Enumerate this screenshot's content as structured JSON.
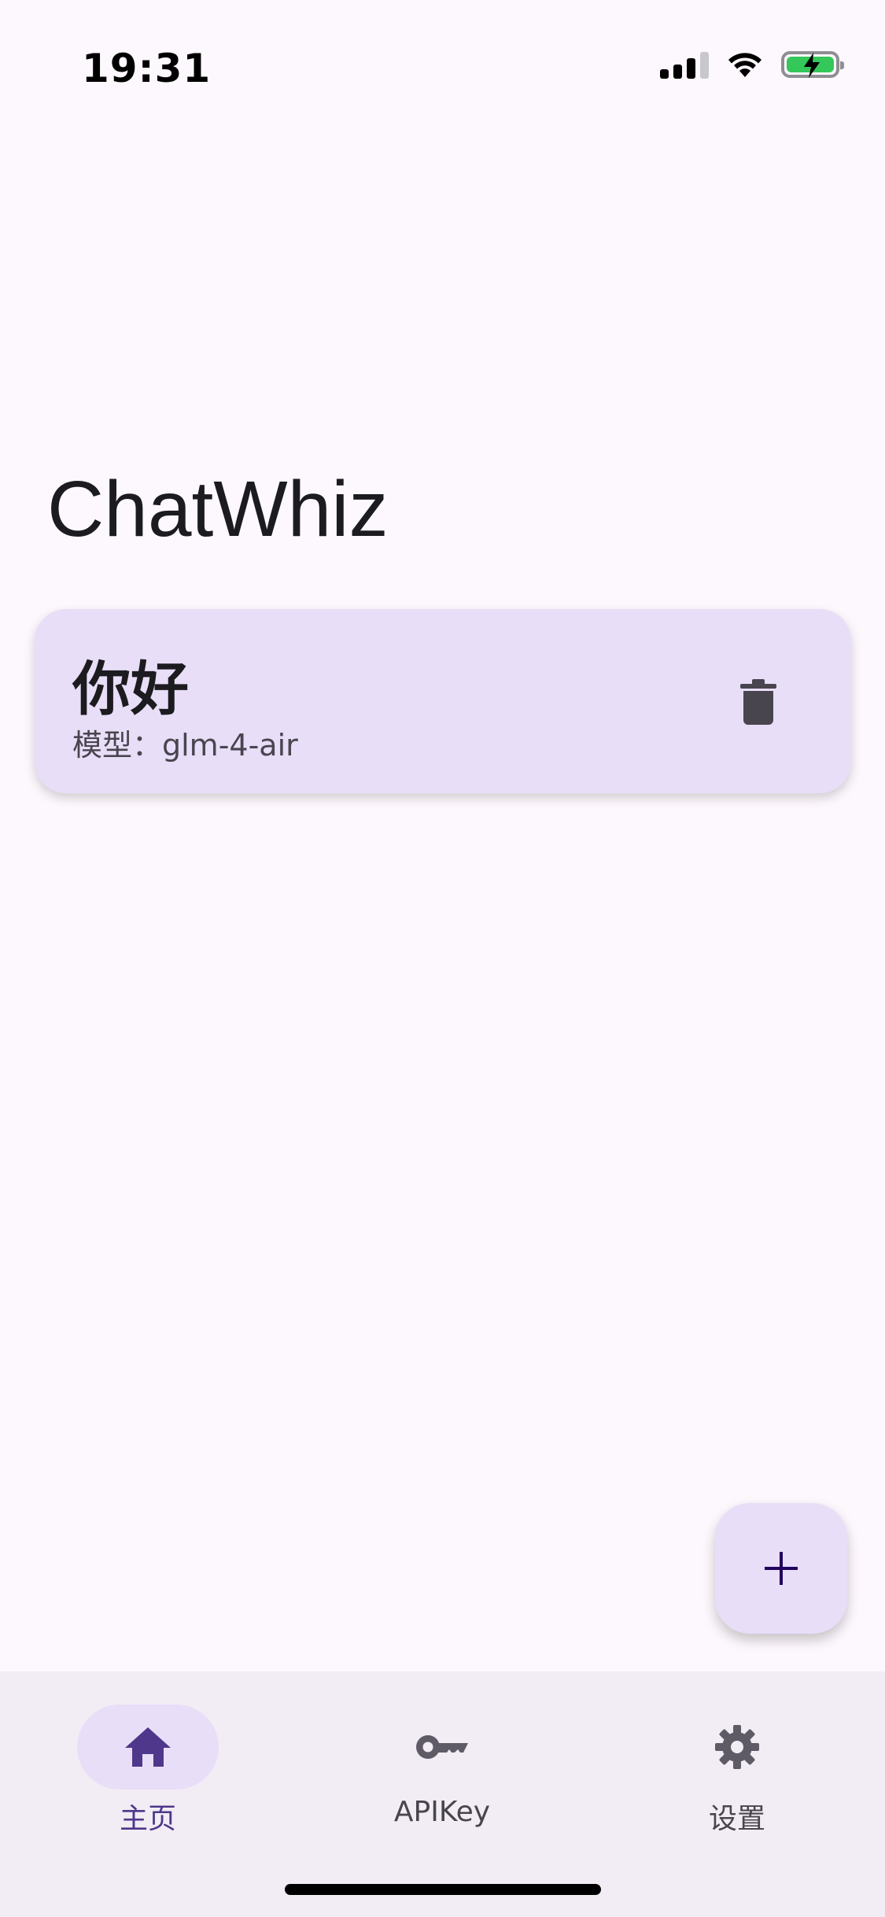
{
  "status_bar": {
    "time": "19:31"
  },
  "app": {
    "title": "ChatWhiz"
  },
  "chats": [
    {
      "title": "你好",
      "subtitle": "模型：glm-4-air"
    }
  ],
  "bottom_nav": {
    "items": [
      {
        "label": "主页",
        "icon": "home-icon",
        "active": true
      },
      {
        "label": "APIKey",
        "icon": "key-icon",
        "active": false
      },
      {
        "label": "设置",
        "icon": "gear-icon",
        "active": false
      }
    ]
  },
  "colors": {
    "background": "#fdf8fd",
    "card": "#e8def8",
    "nav_background": "#f2edf4",
    "active_accent": "#4f378b"
  }
}
